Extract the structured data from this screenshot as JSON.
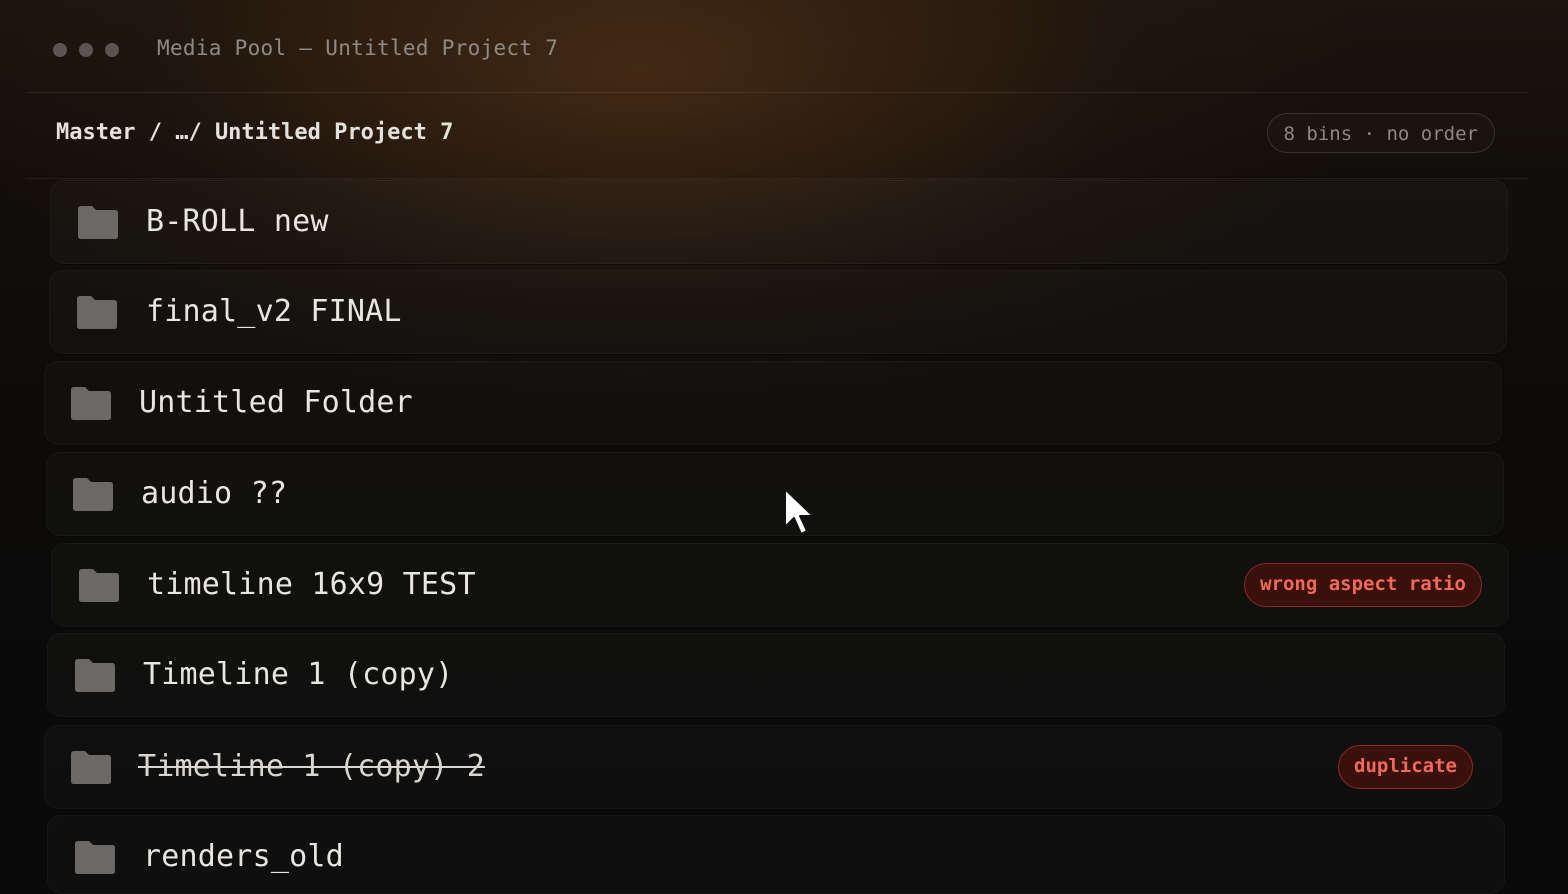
{
  "window": {
    "title": "Media Pool — Untitled Project 7",
    "traffic_lights": [
      "close",
      "minimize",
      "zoom"
    ]
  },
  "path": {
    "breadcrumb": "Master / …/ Untitled Project 7",
    "summary": "8 bins · no order"
  },
  "bins": [
    {
      "name": "B-ROLL new",
      "icon": "folder-icon",
      "struck": false,
      "tag": ""
    },
    {
      "name": "final_v2 FINAL",
      "icon": "folder-icon",
      "struck": false,
      "tag": ""
    },
    {
      "name": "Untitled Folder",
      "icon": "folder-icon",
      "struck": false,
      "tag": ""
    },
    {
      "name": "audio ??",
      "icon": "folder-icon",
      "struck": false,
      "tag": ""
    },
    {
      "name": "timeline 16x9 TEST",
      "icon": "folder-icon",
      "struck": false,
      "tag": "wrong aspect ratio"
    },
    {
      "name": "Timeline 1 (copy)",
      "icon": "folder-icon",
      "struck": false,
      "tag": ""
    },
    {
      "name": "Timeline 1 (copy) 2",
      "icon": "folder-icon",
      "struck": true,
      "tag": "duplicate"
    },
    {
      "name": "renders_old",
      "icon": "folder-icon",
      "struck": false,
      "tag": ""
    }
  ],
  "colors": {
    "tag_text": "#f26a55",
    "tag_border": "#8b2a20",
    "tag_fill": "#3a100c",
    "folder": "#6b6865"
  },
  "pointer": {
    "icon": "mouse-pointer-icon"
  }
}
